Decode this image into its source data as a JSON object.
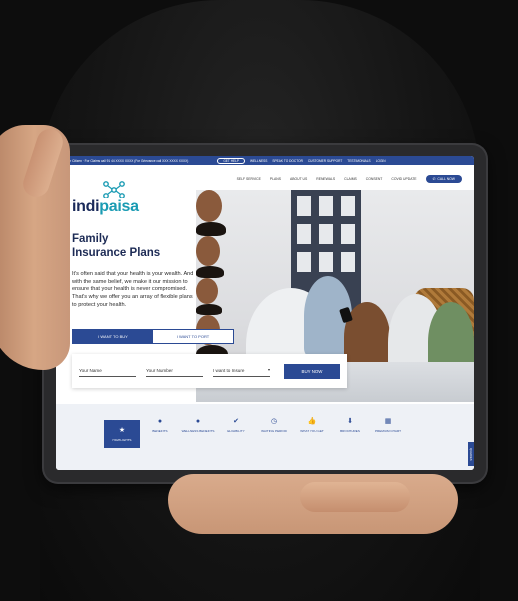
{
  "topbar": {
    "contact": "Senior Citizen · For Claims call 91 44 XXXX XXXX (For Grievance call XXX XXXX XXXX)",
    "help_pill": "GET HELP",
    "links": [
      "WELLNESS",
      "SPEAK TO DOCTOR",
      "CUSTOMER SUPPORT",
      "TESTIMONIALS",
      "LOGIN"
    ]
  },
  "navbar": {
    "items": [
      "SELF SERVICE",
      "PLANS",
      "ABOUT US",
      "RENEWALS",
      "CLAIMS",
      "CONSENT",
      "COVID UPDATE"
    ],
    "call_label": "CALL NOW"
  },
  "logo": {
    "part1": "indi",
    "part2": "paisa"
  },
  "hero": {
    "title_line1": "Family",
    "title_line2": "Insurance Plans",
    "description": "It's often said that your health is your wealth. And with the same belief, we make it our mission to ensure that your health is never compromised. That's why we offer you an array of flexible plans to protect your health."
  },
  "toggle": {
    "buy": "I WANT TO BUY",
    "port": "I WANT TO PORT"
  },
  "form": {
    "name_placeholder": "Your Name",
    "number_placeholder": "Your Number",
    "insure_placeholder": "I want to Insure",
    "buy_label": "BUY NOW"
  },
  "features": [
    {
      "label": "HIGHLIGHTS",
      "icon": "star-icon"
    },
    {
      "label": "BENEFITS",
      "icon": "bag-icon"
    },
    {
      "label": "WELLNESS BENEFITS",
      "icon": "bag-icon"
    },
    {
      "label": "ELIGIBILITY",
      "icon": "check-circle-icon"
    },
    {
      "label": "WAITING PERIOD",
      "icon": "clock-icon"
    },
    {
      "label": "WHAT YOU GET",
      "icon": "thumbs-up-icon"
    },
    {
      "label": "BROCHURES",
      "icon": "download-icon"
    },
    {
      "label": "PREMIUM CHART",
      "icon": "table-icon"
    }
  ],
  "side_tab": "QUERIES",
  "colors": {
    "primary": "#2b4a94",
    "logo_dark": "#1a2a5a",
    "logo_teal": "#1a9bb3"
  }
}
